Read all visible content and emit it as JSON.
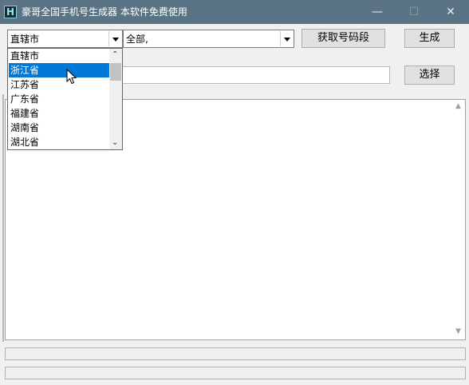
{
  "window": {
    "title": "豪哥全国手机号生成器  本软件免费使用",
    "icon_letter": "H",
    "controls": {
      "minimize": "—",
      "maximize": "☐",
      "close": "✕"
    }
  },
  "province_combo": {
    "value": "直辖市",
    "options": [
      "直辖市",
      "浙江省",
      "江苏省",
      "广东省",
      "福建省",
      "湖南省",
      "湖北省"
    ],
    "highlighted": "浙江省"
  },
  "city_combo": {
    "value": "全部,"
  },
  "buttons": {
    "fetch": "获取号码段",
    "generate": "生成",
    "choose": "选择"
  },
  "path_input": {
    "value": ""
  },
  "output": {
    "text": ""
  },
  "status_bar_1": "",
  "status_bar_2": "",
  "colors": {
    "titlebar": "#5b7485",
    "selection": "#0078d7",
    "background": "#f0f0f0"
  }
}
